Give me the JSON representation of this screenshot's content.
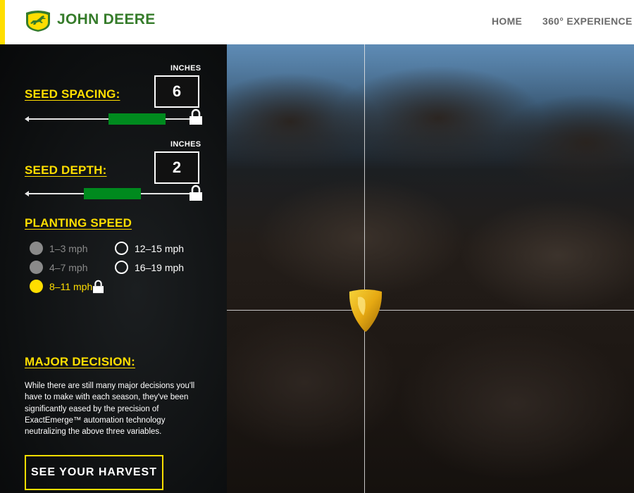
{
  "header": {
    "brand": "JOHN DEERE",
    "nav": {
      "home": "HOME",
      "experience": "360° EXPERIENCE"
    },
    "colors": {
      "brand_green": "#367c2b",
      "accent_yellow": "#ffde00"
    }
  },
  "controls": {
    "seed_spacing": {
      "title": "SEED SPACING:",
      "unit": "INCHES",
      "value": "6",
      "locked": true
    },
    "seed_depth": {
      "title": "SEED DEPTH:",
      "unit": "INCHES",
      "value": "2",
      "locked": true
    },
    "planting_speed": {
      "title": "PLANTING SPEED",
      "options": [
        {
          "label": "1–3 mph",
          "state": "disabled"
        },
        {
          "label": "4–7 mph",
          "state": "disabled"
        },
        {
          "label": "8–11 mph",
          "state": "selected",
          "locked": true
        },
        {
          "label": "12–15 mph",
          "state": "available"
        },
        {
          "label": "16–19 mph",
          "state": "available"
        }
      ]
    }
  },
  "decision": {
    "title": "MAJOR DECISION:",
    "text": "While there are still many major decisions you'll have to make with each season, they've been significantly eased by the precision of ExactEmerge™ automation technology neutralizing the above three variables."
  },
  "cta": {
    "label": "SEE YOUR HARVEST"
  },
  "icons": [
    "deer-logo-icon",
    "lock-icon",
    "arrow-left-icon",
    "corn-seed-icon"
  ]
}
